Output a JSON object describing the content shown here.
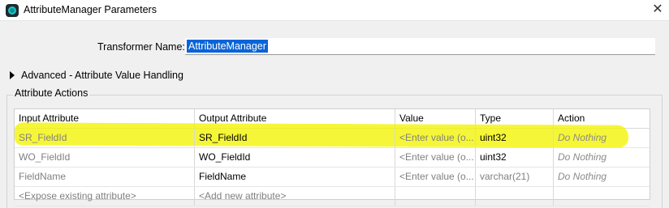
{
  "window": {
    "title": "AttributeManager Parameters",
    "close_glyph": "✕"
  },
  "transformer_name": {
    "label": "Transformer Name:",
    "value": "AttributeManager"
  },
  "advanced": {
    "label": "Advanced - Attribute Value Handling",
    "icon": "triangle-right-icon"
  },
  "attribute_actions": {
    "group_label": "Attribute Actions",
    "columns": [
      "Input Attribute",
      "Output Attribute",
      "Value",
      "Type",
      "Action"
    ],
    "rows": [
      {
        "input": "SR_FieldId",
        "output": "SR_FieldId",
        "value": "<Enter value (o...",
        "type": "uint32",
        "action": "Do Nothing",
        "highlighted": true
      },
      {
        "input": "WO_FieldId",
        "output": "WO_FieldId",
        "value": "<Enter value (o...",
        "type": "uint32",
        "action": "Do Nothing",
        "highlighted": false
      },
      {
        "input": "FieldName",
        "output": "FieldName",
        "value": "<Enter value (o...",
        "type": "varchar(21)",
        "action": "Do Nothing",
        "highlighted": false
      },
      {
        "input": "<Expose existing attribute>",
        "output": "<Add new attribute>",
        "value": "",
        "type": "",
        "action": "",
        "highlighted": false
      }
    ]
  },
  "colors": {
    "highlight": "#f3f300",
    "selection": "#0a64d8",
    "app_icon": "#19c7c7"
  }
}
